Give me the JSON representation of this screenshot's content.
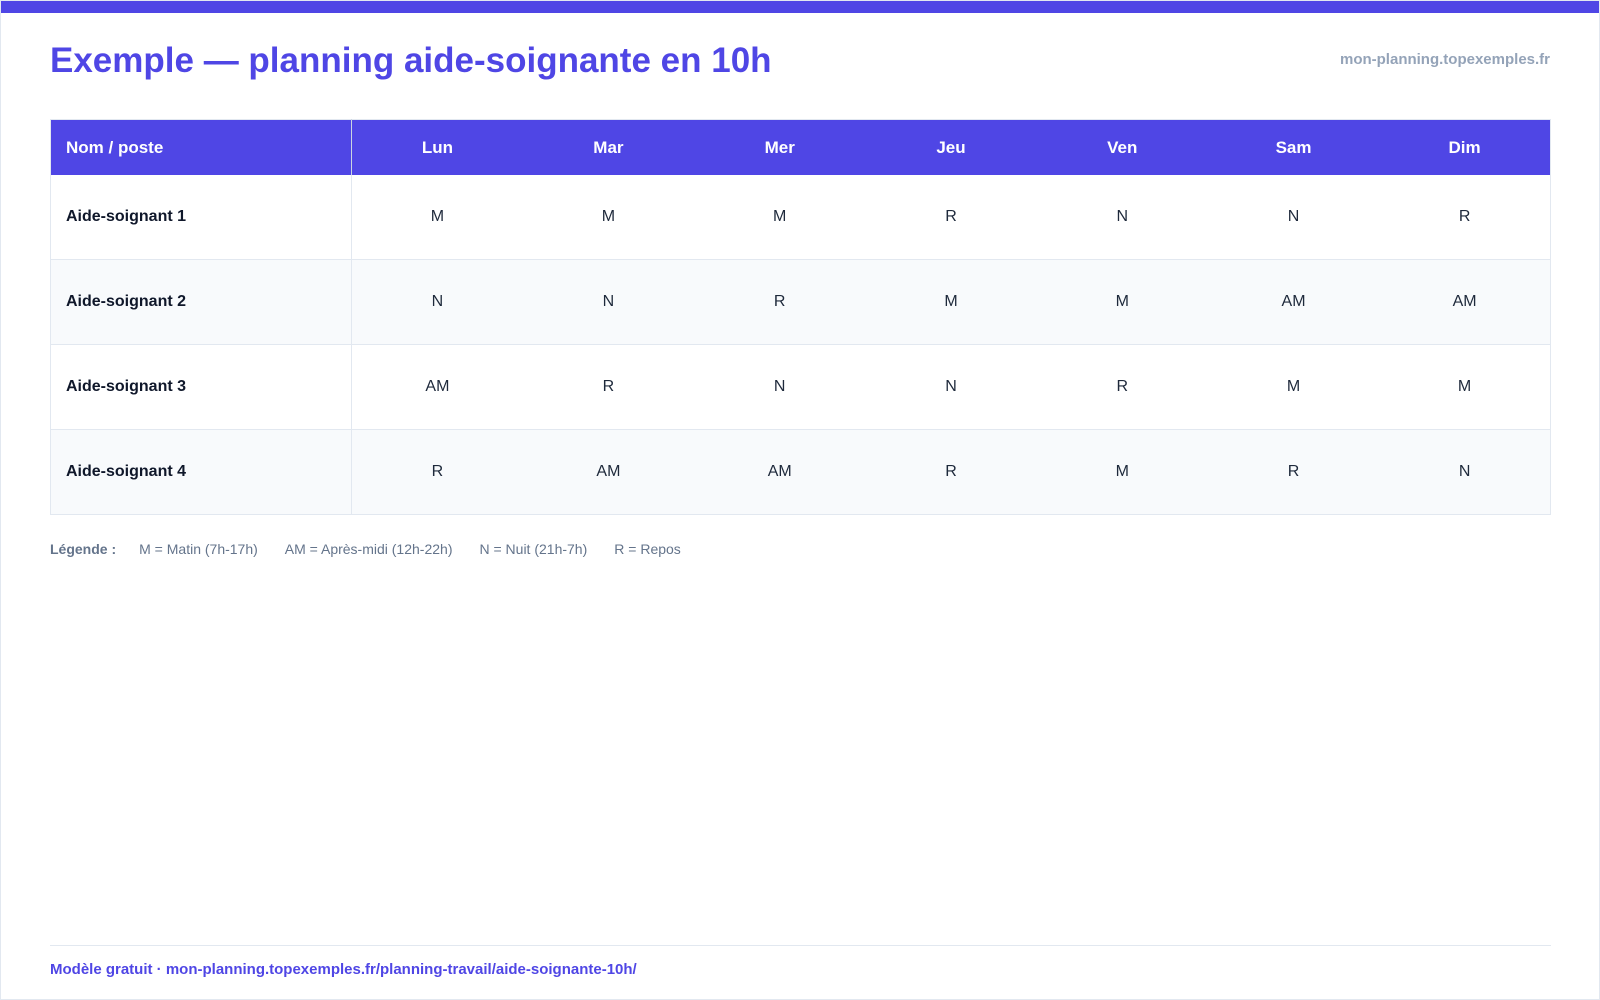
{
  "header": {
    "title": "Exemple — planning aide-soignante en 10h",
    "site": "mon-planning.topexemples.fr"
  },
  "colors": {
    "accent": "#4f46e5",
    "muted": "#94a3b8"
  },
  "table": {
    "name_header": "Nom / poste",
    "days": [
      "Lun",
      "Mar",
      "Mer",
      "Jeu",
      "Ven",
      "Sam",
      "Dim"
    ],
    "rows": [
      {
        "name": "Aide-soignant 1",
        "shifts": [
          "M",
          "M",
          "M",
          "R",
          "N",
          "N",
          "R"
        ]
      },
      {
        "name": "Aide-soignant 2",
        "shifts": [
          "N",
          "N",
          "R",
          "M",
          "M",
          "AM",
          "AM"
        ]
      },
      {
        "name": "Aide-soignant 3",
        "shifts": [
          "AM",
          "R",
          "N",
          "N",
          "R",
          "M",
          "M"
        ]
      },
      {
        "name": "Aide-soignant 4",
        "shifts": [
          "R",
          "AM",
          "AM",
          "R",
          "M",
          "R",
          "N"
        ]
      }
    ]
  },
  "legend": {
    "label": "Légende :",
    "items": [
      "M = Matin (7h-17h)",
      "AM = Après-midi (12h-22h)",
      "N = Nuit (21h-7h)",
      "R = Repos"
    ]
  },
  "footer": {
    "text": "Modèle gratuit · mon-planning.topexemples.fr/planning-travail/aide-soignante-10h/"
  }
}
